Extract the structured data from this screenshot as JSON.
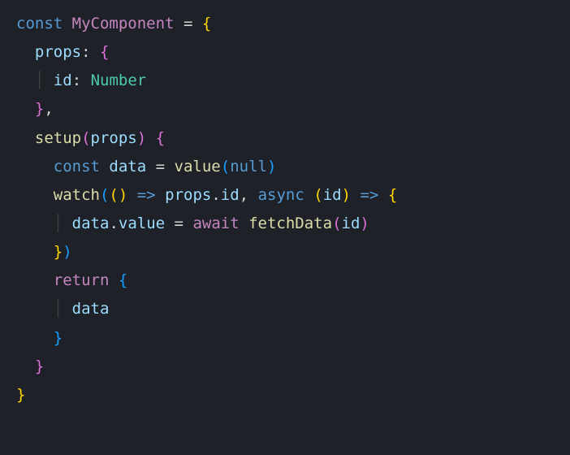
{
  "code": {
    "l1": {
      "const": "const",
      "name": "MyComponent",
      "eq": "=",
      "ob": "{"
    },
    "l2": {
      "props": "props",
      "colon": ":",
      "ob": "{"
    },
    "l3": {
      "id": "id",
      "colon": ":",
      "type": "Number"
    },
    "l4": {
      "cb": "}",
      "comma": ","
    },
    "l5": {
      "setup": "setup",
      "op": "(",
      "arg": "props",
      "cp": ")",
      "ob": "{"
    },
    "l6": {
      "const": "const",
      "data": "data",
      "eq": "=",
      "fn": "value",
      "op": "(",
      "null": "null",
      "cp": ")"
    },
    "l7": {
      "watch": "watch",
      "op1": "(",
      "op2": "(",
      "cp2": ")",
      "arrow": "=>",
      "props": "props",
      "dot": ".",
      "id": "id",
      "comma": ",",
      "async": "async",
      "op3": "(",
      "arg": "id",
      "cp3": ")",
      "arrow2": "=>",
      "ob": "{"
    },
    "l8": {
      "data": "data",
      "dot": ".",
      "value": "value",
      "eq": "=",
      "await": "await",
      "fn": "fetchData",
      "op": "(",
      "arg": "id",
      "cp": ")"
    },
    "l9": {
      "cb": "}",
      "cp": ")"
    },
    "l10": {
      "return": "return",
      "ob": "{"
    },
    "l11": {
      "data": "data"
    },
    "l12": {
      "cb": "}"
    },
    "l13": {
      "cb": "}"
    },
    "l14": {
      "cb": "}"
    }
  }
}
